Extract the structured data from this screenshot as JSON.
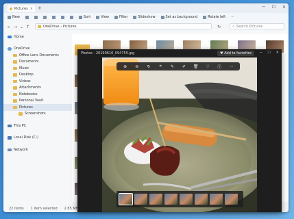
{
  "explorer": {
    "tab_title": "Pictures",
    "toolbar": [
      {
        "label": "New",
        "icon": "new-icon"
      },
      {
        "label": "Sort",
        "icon": "sort-icon"
      },
      {
        "label": "View",
        "icon": "view-icon"
      },
      {
        "label": "Filter",
        "icon": "filter-icon"
      },
      {
        "label": "Slideshow",
        "icon": "slideshow-icon"
      },
      {
        "label": "Set as background",
        "icon": "background-icon"
      },
      {
        "label": "Rotate left",
        "icon": "rotate-icon"
      }
    ],
    "address": "OneDrive › Pictures",
    "search_placeholder": "Search Pictures",
    "sidebar": [
      {
        "label": "Home",
        "type": "top",
        "icon": "home-icon"
      },
      {
        "label": "OneDrive",
        "type": "top",
        "icon": "cloud-icon"
      },
      {
        "label": "Office Lens Documents",
        "type": "folder"
      },
      {
        "label": "Documents",
        "type": "folder"
      },
      {
        "label": "Music",
        "type": "folder"
      },
      {
        "label": "Desktop",
        "type": "folder"
      },
      {
        "label": "Videos",
        "type": "folder"
      },
      {
        "label": "Attachments",
        "type": "folder"
      },
      {
        "label": "Notebooks",
        "type": "folder"
      },
      {
        "label": "Personal Vault",
        "type": "folder"
      },
      {
        "label": "Pictures",
        "type": "folder",
        "selected": true
      },
      {
        "label": "Screenshots",
        "type": "sub"
      },
      {
        "label": "This PC",
        "type": "top",
        "icon": "pc-icon"
      },
      {
        "label": "Local Disk (C:)",
        "type": "top",
        "icon": "drive-icon"
      },
      {
        "label": "Network",
        "type": "top",
        "icon": "network-icon"
      }
    ],
    "status": {
      "items": "22 items",
      "selected": "1 item selected",
      "size": "2.85 MB"
    }
  },
  "photos": {
    "title": "Photos - 20190616_094755.jpg",
    "favorite_label": "Add to favorites",
    "toolbar_icons": [
      "zoom-in-icon",
      "zoom-out-icon",
      "rotate-icon",
      "crop-icon",
      "edit-icon",
      "draw-icon",
      "delete-icon",
      "favorite-icon",
      "info-icon",
      "more-icon"
    ],
    "filmstrip_count": 8
  }
}
